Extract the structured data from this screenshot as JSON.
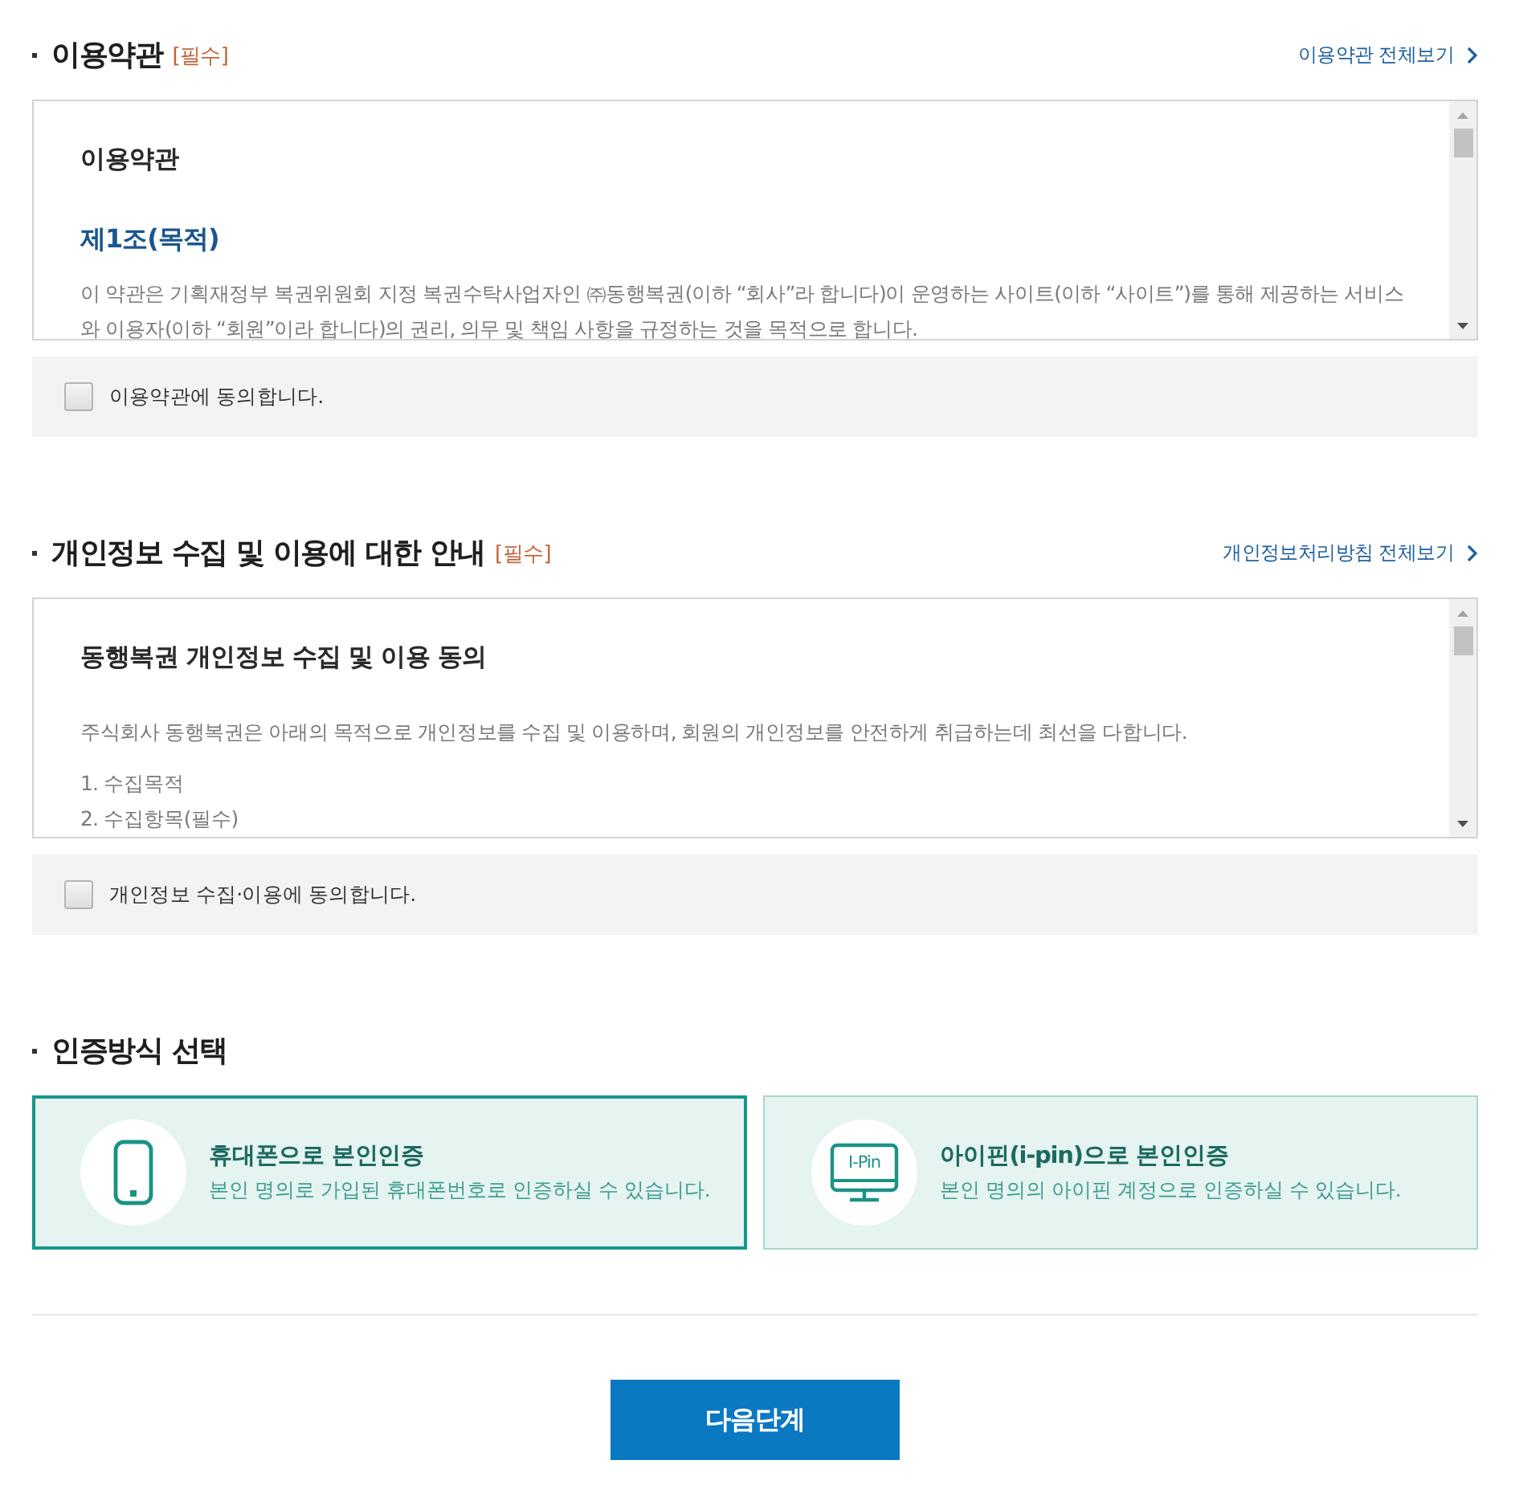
{
  "sections": [
    {
      "title": "이용약관",
      "required_tag": "[필수]",
      "view_all_link": "이용약관 전체보기",
      "document": {
        "heading": "이용약관",
        "blocks": [
          {
            "kind": "subheading",
            "text": "제1조(목적)"
          },
          {
            "kind": "paragraph",
            "text": "이 약관은 기획재정부 복권위원회 지정 복권수탁사업자인 ㈜동행복권(이하 “회사”라 합니다)이 운영하는 사이트(이하 “사이트”)를 통해 제공하는 서비스와 이용자(이하 “회원”이라 합니다)의 권리, 의무 및 책임 사항을 규정하는 것을 목적으로 합니다."
          }
        ]
      },
      "agreement": {
        "label": "이용약관에 동의합니다.",
        "checked": false
      }
    },
    {
      "title": "개인정보 수집 및 이용에 대한 안내",
      "required_tag": "[필수]",
      "view_all_link": "개인정보처리방침 전체보기",
      "document": {
        "heading": "동행복권 개인정보 수집 및 이용 동의",
        "blocks": [
          {
            "kind": "paragraph",
            "text": "주식회사 동행복권은 아래의 목적으로 개인정보를 수집 및 이용하며, 회원의 개인정보를 안전하게 취급하는데 최선을 다합니다."
          },
          {
            "kind": "list_item",
            "text": "1. 수집목적"
          },
          {
            "kind": "list_item",
            "text": "2. 수집항목(필수)"
          }
        ]
      },
      "agreement": {
        "label": "개인정보 수집·이용에 동의합니다.",
        "checked": false
      }
    }
  ],
  "verification": {
    "title": "인증방식 선택",
    "options": [
      {
        "kind": "phone",
        "title": "휴대폰으로 본인인증",
        "description": "본인 명의로 가입된 휴대폰번호로 인증하실 수 있습니다.",
        "selected": true
      },
      {
        "kind": "ipin",
        "icon_label": "I-Pin",
        "title": "아이핀(i-pin)으로 본인인증",
        "description": "본인 명의의 아이핀 계정으로 인증하실 수 있습니다.",
        "selected": false
      }
    ]
  },
  "next_button": "다음단계"
}
